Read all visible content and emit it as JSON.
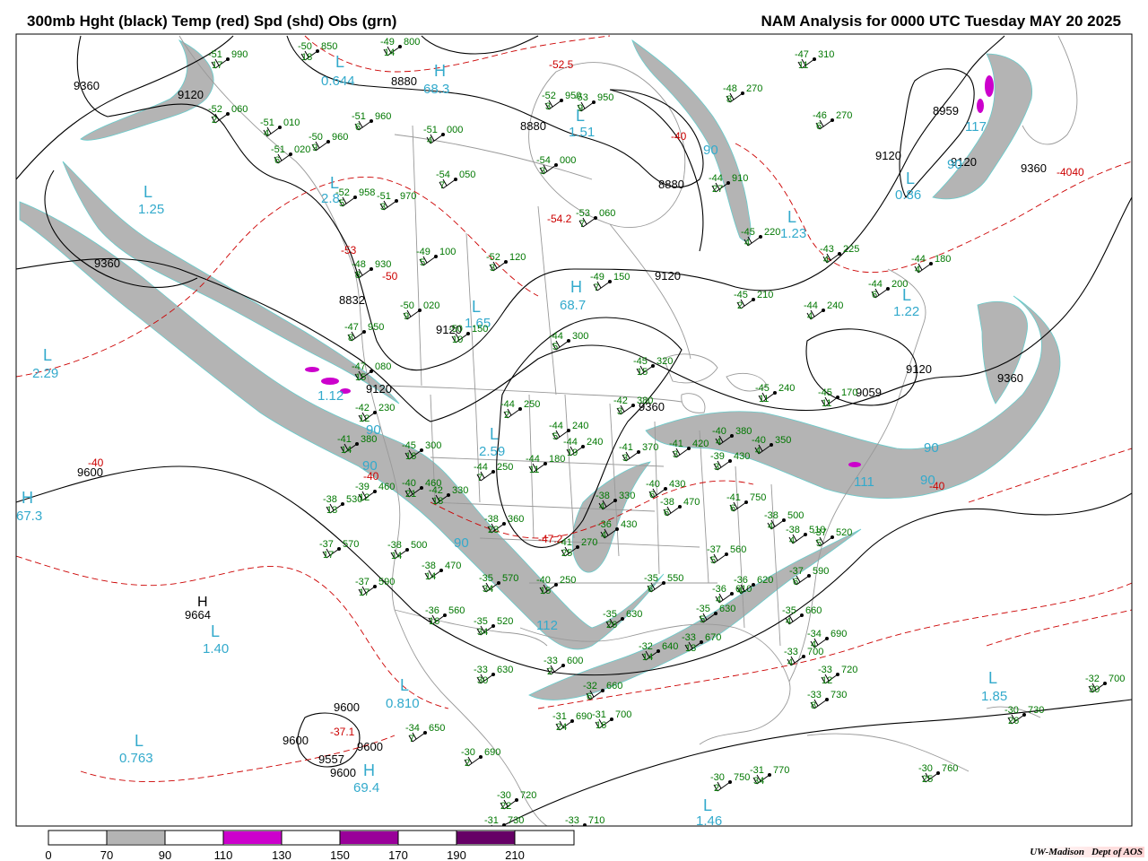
{
  "header": {
    "left_title": "300mb Hght (black) Temp (red) Spd (shd) Obs (grn)",
    "right_title": "NAM Analysis for 0000 UTC Tuesday  MAY 20 2025"
  },
  "colors": {
    "height_contour": "#000000",
    "temperature_contour": "#cc0000",
    "speed_shade_70_90": "#b4b4b4",
    "speed_shade_110_130": "#cc00cc",
    "speed_shade_150_170": "#990099",
    "speed_shade_190_210": "#660066",
    "observations": "#007700",
    "center_labels": "#33aacc",
    "geography": "#999999"
  },
  "legend": {
    "ticks": [
      "0",
      "70",
      "90",
      "110",
      "130",
      "150",
      "170",
      "190",
      "210"
    ],
    "shaded_bins": [
      {
        "from": "70",
        "to": "90",
        "color": "#b4b4b4"
      },
      {
        "from": "110",
        "to": "130",
        "color": "#cc00cc"
      },
      {
        "from": "150",
        "to": "170",
        "color": "#990099"
      },
      {
        "from": "190",
        "to": "210",
        "color": "#660066"
      }
    ]
  },
  "credit": {
    "institution": "UW-Madison",
    "department": "Dept of AOS"
  },
  "height_labels": [
    "9360",
    "9120",
    "8880",
    "8880",
    "8880",
    "8959",
    "9120",
    "9360",
    "9360",
    "9120",
    "9120",
    "9120",
    "9360",
    "9600",
    "9600",
    "9600",
    "9600",
    "9600",
    "9557",
    "9664",
    "9360",
    "9120",
    "9120",
    "8832",
    "9059"
  ],
  "temperature_labels": [
    "-52.5",
    "-53",
    "-50",
    "-40",
    "-40",
    "-47.2",
    "-37.1",
    "-54.2",
    "-40",
    "-40",
    "-4040"
  ],
  "pressure_centers": [
    {
      "type": "H",
      "value": "68.3"
    },
    {
      "type": "L",
      "value": "0.644"
    },
    {
      "type": "L",
      "value": "1.25"
    },
    {
      "type": "L",
      "value": "2.29"
    },
    {
      "type": "L",
      "value": "1.51"
    },
    {
      "type": "L",
      "value": "2.8"
    },
    {
      "type": "H",
      "value": "68.7"
    },
    {
      "type": "L",
      "value": "1.65"
    },
    {
      "type": "L",
      "value": "2.59"
    },
    {
      "type": "H",
      "value": "67.3"
    },
    {
      "type": "H",
      "value": "9664"
    },
    {
      "type": "L",
      "value": "1.40"
    },
    {
      "type": "L",
      "value": "0.810"
    },
    {
      "type": "L",
      "value": "0.763"
    },
    {
      "type": "H",
      "value": "69.4"
    },
    {
      "type": "L",
      "value": "1.85"
    },
    {
      "type": "L",
      "value": "1.46"
    },
    {
      "type": "L",
      "value": "1.22"
    },
    {
      "type": "L",
      "value": "1.23"
    },
    {
      "type": "L",
      "value": "0.86"
    },
    {
      "type": "L",
      "value": "1.12"
    }
  ],
  "speed_labels": [
    "90",
    "90",
    "90",
    "90",
    "90",
    "90",
    "90",
    "111",
    "117",
    "112"
  ],
  "observations": [
    {
      "temp": "-51",
      "hgt": "990",
      "dew": "17"
    },
    {
      "temp": "-50",
      "hgt": "850",
      "dew": "18"
    },
    {
      "temp": "-49",
      "hgt": "800",
      "dew": "14"
    },
    {
      "temp": "-52",
      "hgt": "060",
      "dew": "2"
    },
    {
      "temp": "-51",
      "hgt": "010",
      "dew": "4"
    },
    {
      "temp": "-51",
      "hgt": "960",
      "dew": "6"
    },
    {
      "temp": "-50",
      "hgt": "960",
      "dew": "9"
    },
    {
      "temp": "-51",
      "hgt": "020",
      "dew": "6"
    },
    {
      "temp": "-51",
      "hgt": "000",
      "dew": "4"
    },
    {
      "temp": "-54",
      "hgt": "050",
      "dew": "7"
    },
    {
      "temp": "-54",
      "hgt": "000",
      "dew": "3"
    },
    {
      "temp": "-53",
      "hgt": "950",
      "dew": "9"
    },
    {
      "temp": "-52",
      "hgt": "950",
      "dew": "3"
    },
    {
      "temp": "-47",
      "hgt": "310",
      "dew": "11"
    },
    {
      "temp": "-48",
      "hgt": "270",
      "dew": "8"
    },
    {
      "temp": "-46",
      "hgt": "270",
      "dew": "6"
    },
    {
      "temp": "-44",
      "hgt": "910",
      "dew": "27"
    },
    {
      "temp": "-53",
      "hgt": "060",
      "dew": "7"
    },
    {
      "temp": "-52",
      "hgt": "958",
      "dew": "5"
    },
    {
      "temp": "-51",
      "hgt": "970",
      "dew": "3"
    },
    {
      "temp": "-49",
      "hgt": "100",
      "dew": "5"
    },
    {
      "temp": "-52",
      "hgt": "120",
      "dew": "3"
    },
    {
      "temp": "-49",
      "hgt": "150",
      "dew": "7"
    },
    {
      "temp": "-45",
      "hgt": "220",
      "dew": "4"
    },
    {
      "temp": "-43",
      "hgt": "225",
      "dew": "4"
    },
    {
      "temp": "-44",
      "hgt": "180",
      "dew": "4"
    },
    {
      "temp": "-44",
      "hgt": "200",
      "dew": "6"
    },
    {
      "temp": "-48",
      "hgt": "930",
      "dew": "8"
    },
    {
      "temp": "-50",
      "hgt": "020",
      "dew": "9"
    },
    {
      "temp": "-50",
      "hgt": "150",
      "dew": "10"
    },
    {
      "temp": "-45",
      "hgt": "210",
      "dew": "2"
    },
    {
      "temp": "-44",
      "hgt": "240",
      "dew": "4"
    },
    {
      "temp": "-47",
      "hgt": "950",
      "dew": "8"
    },
    {
      "temp": "-44",
      "hgt": "300",
      "dew": "5"
    },
    {
      "temp": "-45",
      "hgt": "320",
      "dew": "15"
    },
    {
      "temp": "-47",
      "hgt": "080",
      "dew": "15"
    },
    {
      "temp": "-44",
      "hgt": "250",
      "dew": "2"
    },
    {
      "temp": "-42",
      "hgt": "380",
      "dew": "3"
    },
    {
      "temp": "-45",
      "hgt": "240",
      "dew": "11"
    },
    {
      "temp": "-45",
      "hgt": "170",
      "dew": "11"
    },
    {
      "temp": "-42",
      "hgt": "230",
      "dew": "12"
    },
    {
      "temp": "-44",
      "hgt": "240",
      "dew": "5"
    },
    {
      "temp": "-44",
      "hgt": "240",
      "dew": "19"
    },
    {
      "temp": "-41",
      "hgt": "370",
      "dew": "3"
    },
    {
      "temp": "-41",
      "hgt": "420",
      "dew": "3"
    },
    {
      "temp": "-39",
      "hgt": "430",
      "dew": "3"
    },
    {
      "temp": "-40",
      "hgt": "380",
      "dew": "4"
    },
    {
      "temp": "-40",
      "hgt": "350",
      "dew": "4"
    },
    {
      "temp": "-41",
      "hgt": "380",
      "dew": "14"
    },
    {
      "temp": "-45",
      "hgt": "300",
      "dew": "16"
    },
    {
      "temp": "-44",
      "hgt": "250",
      "dew": "7"
    },
    {
      "temp": "-44",
      "hgt": "180",
      "dew": "11"
    },
    {
      "temp": "-40",
      "hgt": "430",
      "dew": "6"
    },
    {
      "temp": "-38",
      "hgt": "470",
      "dew": "6"
    },
    {
      "temp": "-41",
      "hgt": "750",
      "dew": "6"
    },
    {
      "temp": "-38",
      "hgt": "500",
      "dew": "4"
    },
    {
      "temp": "-38",
      "hgt": "510",
      "dew": "4"
    },
    {
      "temp": "-37",
      "hgt": "520",
      "dew": "5"
    },
    {
      "temp": "-37",
      "hgt": "560",
      "dew": "5"
    },
    {
      "temp": "-37",
      "hgt": "590",
      "dew": "6"
    },
    {
      "temp": "-38",
      "hgt": "530",
      "dew": "13"
    },
    {
      "temp": "-39",
      "hgt": "460",
      "dew": "12"
    },
    {
      "temp": "-40",
      "hgt": "460",
      "dew": "21"
    },
    {
      "temp": "-42",
      "hgt": "330",
      "dew": "18"
    },
    {
      "temp": "-38",
      "hgt": "360",
      "dew": "23"
    },
    {
      "temp": "-38",
      "hgt": "330",
      "dew": "4"
    },
    {
      "temp": "-36",
      "hgt": "430",
      "dew": "4"
    },
    {
      "temp": "-41",
      "hgt": "270",
      "dew": "25"
    },
    {
      "temp": "-37",
      "hgt": "570",
      "dew": "17"
    },
    {
      "temp": "-38",
      "hgt": "500",
      "dew": "14"
    },
    {
      "temp": "-38",
      "hgt": "470",
      "dew": "14"
    },
    {
      "temp": "-37",
      "hgt": "590",
      "dew": "17"
    },
    {
      "temp": "-35",
      "hgt": "570",
      "dew": "34"
    },
    {
      "temp": "-40",
      "hgt": "250",
      "dew": "15"
    },
    {
      "temp": "-36",
      "hgt": "560",
      "dew": "16"
    },
    {
      "temp": "-35",
      "hgt": "520",
      "dew": "34"
    },
    {
      "temp": "-35",
      "hgt": "550",
      "dew": "6"
    },
    {
      "temp": "-36",
      "hgt": "610",
      "dew": "4"
    },
    {
      "temp": "-36",
      "hgt": "620",
      "dew": "4"
    },
    {
      "temp": "-35",
      "hgt": "630",
      "dew": "5"
    },
    {
      "temp": "-35",
      "hgt": "660",
      "dew": "4"
    },
    {
      "temp": "-34",
      "hgt": "690",
      "dew": "4"
    },
    {
      "temp": "-33",
      "hgt": "670",
      "dew": "13"
    },
    {
      "temp": "-32",
      "hgt": "640",
      "dew": "14"
    },
    {
      "temp": "-33",
      "hgt": "700",
      "dew": "4"
    },
    {
      "temp": "-33",
      "hgt": "720",
      "dew": "12"
    },
    {
      "temp": "-33",
      "hgt": "730",
      "dew": "8"
    },
    {
      "temp": "-35",
      "hgt": "630",
      "dew": "26"
    },
    {
      "temp": "-33",
      "hgt": "630",
      "dew": "30"
    },
    {
      "temp": "-33",
      "hgt": "600",
      "dew": "2"
    },
    {
      "temp": "-32",
      "hgt": "660",
      "dew": "6"
    },
    {
      "temp": "-31",
      "hgt": "700",
      "dew": "16"
    },
    {
      "temp": "-31",
      "hgt": "690",
      "dew": "24"
    },
    {
      "temp": "-34",
      "hgt": "650",
      "dew": "7"
    },
    {
      "temp": "-30",
      "hgt": "690",
      "dew": "2"
    },
    {
      "temp": "-30",
      "hgt": "720",
      "dew": "22"
    },
    {
      "temp": "-31",
      "hgt": "730",
      "dew": "8"
    },
    {
      "temp": "-30",
      "hgt": "750",
      "dew": "2"
    },
    {
      "temp": "-31",
      "hgt": "770",
      "dew": "34"
    },
    {
      "temp": "-30",
      "hgt": "760",
      "dew": "25"
    },
    {
      "temp": "-30",
      "hgt": "730",
      "dew": "26"
    },
    {
      "temp": "-32",
      "hgt": "700",
      "dew": "30"
    },
    {
      "temp": "-33",
      "hgt": "710",
      "dew": "9"
    },
    {
      "temp": "-35",
      "hgt": "630",
      "dew": "26"
    }
  ]
}
